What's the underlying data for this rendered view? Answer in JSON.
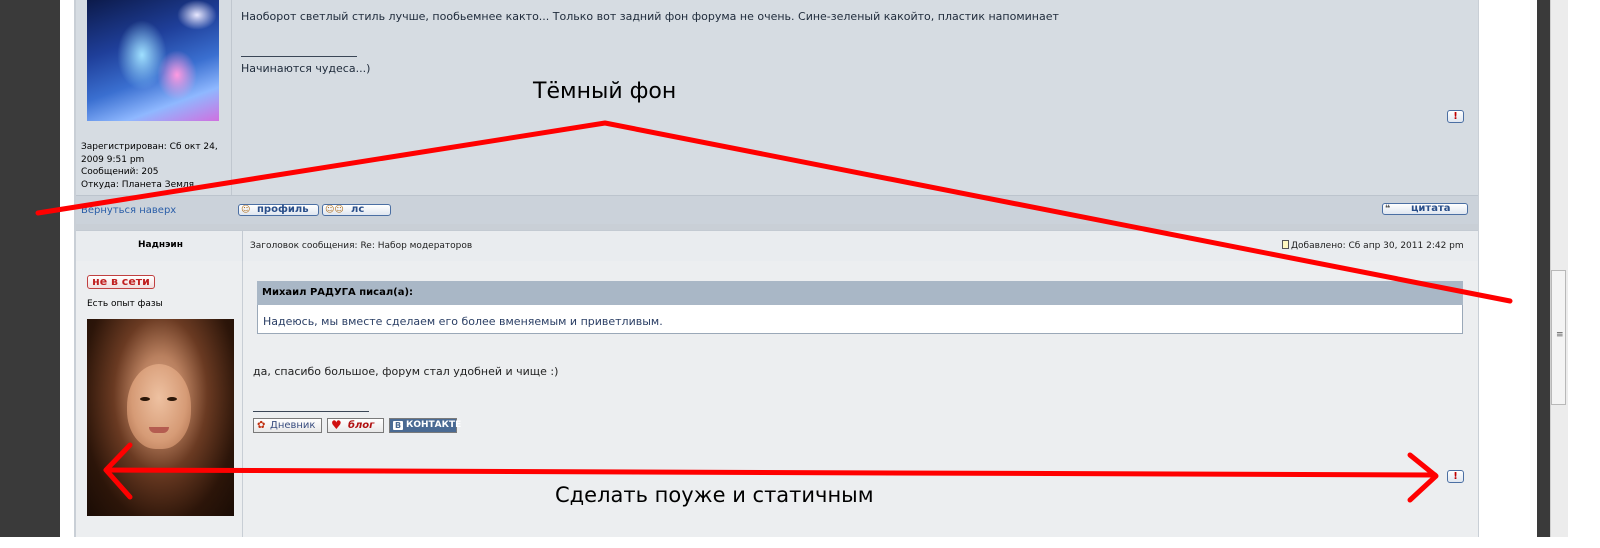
{
  "post1": {
    "message": "Наоборот светлый стиль лучше, пообьемнее както... Только вот задний фон форума не очень. Сине-зеленый какойто, пластик напоминает",
    "signature": "Начинаются чудеса...)",
    "user_info": {
      "registered": "Зарегистрирован: Сб окт 24,",
      "registered_time": "2009 9:51 pm",
      "posts": "Сообщений: 205",
      "from": "Откуда: Планета Земля"
    },
    "back_to_top": "Вернуться наверх",
    "buttons": {
      "profile": "профиль",
      "pm": "лс",
      "quote": "цитата"
    }
  },
  "post2": {
    "author": "Наднэин",
    "subject": "Заголовок сообщения: Re: Набор модераторов",
    "added": "Добавлено: Сб апр 30, 2011 2:42 pm",
    "status": "не в сети",
    "rank": "Есть опыт фазы",
    "quote": {
      "title": "Михаил РАДУГА писал(а):",
      "text": "Надеюсь, мы вместе сделаем его более вменяемым и приветливым."
    },
    "message": "да, спасибо большое, форум стал удобней и чище :)",
    "sig_buttons": {
      "diary": "Дневник",
      "blog": "блог",
      "vk": "КОНТАКТЕ"
    }
  },
  "annotations": {
    "dark_bg": "Тёмный фон",
    "narrower": "Сделать поуже и статичным",
    "color": "#ff0000"
  }
}
